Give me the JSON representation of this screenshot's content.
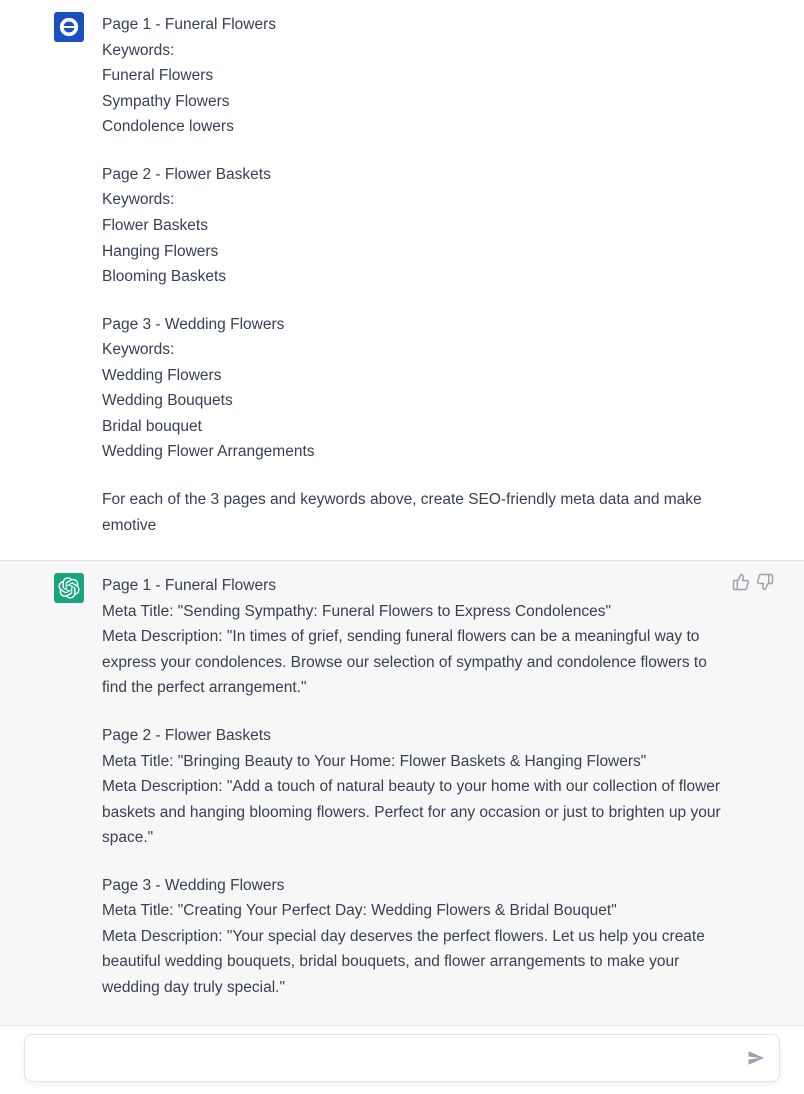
{
  "user_message": {
    "lines": [
      "Page 1 - Funeral Flowers",
      "Keywords:",
      "Funeral Flowers",
      "Sympathy Flowers",
      "Condolence lowers",
      "",
      "Page 2 - Flower Baskets",
      "Keywords:",
      "Flower Baskets",
      "Hanging Flowers",
      "Blooming Baskets",
      "",
      "Page 3 - Wedding Flowers",
      "Keywords:",
      "Wedding Flowers",
      "Wedding Bouquets",
      "Bridal bouquet",
      "Wedding Flower Arrangements",
      "",
      "For each of the 3 pages and keywords above, create SEO-friendly meta data and make emotive"
    ]
  },
  "assistant_message": {
    "lines": [
      "Page 1 - Funeral Flowers",
      "Meta Title: \"Sending Sympathy: Funeral Flowers to Express Condolences\"",
      "Meta Description: \"In times of grief, sending funeral flowers can be a meaningful way to express your condolences. Browse our selection of sympathy and condolence flowers to find the perfect arrangement.\"",
      "",
      "Page 2 - Flower Baskets",
      "Meta Title: \"Bringing Beauty to Your Home: Flower Baskets & Hanging Flowers\"",
      "Meta Description: \"Add a touch of natural beauty to your home with our collection of flower baskets and hanging blooming flowers. Perfect for any occasion or just to brighten up your space.\"",
      "",
      "Page 3 - Wedding Flowers",
      "Meta Title: \"Creating Your Perfect Day: Wedding Flowers & Bridal Bouquet\"",
      "Meta Description: \"Your special day deserves the perfect flowers. Let us help you create beautiful wedding bouquets, bridal bouquets, and flower arrangements to make your wedding day truly special.\""
    ]
  },
  "input": {
    "placeholder": ""
  }
}
